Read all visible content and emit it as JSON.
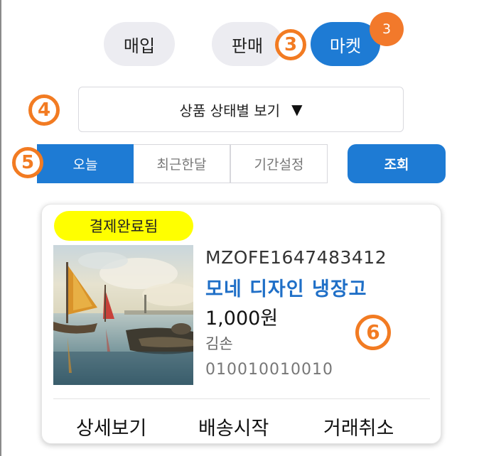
{
  "tabs": {
    "buy_label": "매입",
    "sell_label": "판매",
    "market_label": "마켓",
    "market_count": "3"
  },
  "markers": {
    "m3": "3",
    "m4": "4",
    "m5": "5",
    "m6": "6"
  },
  "filter": {
    "dropdown_label": "상품 상태별 보기",
    "dropdown_caret": "▼",
    "periods": [
      "오늘",
      "최근한달",
      "기간설정"
    ],
    "selected_period": "오늘",
    "search_label": "조회"
  },
  "order": {
    "status": "결제완료됨",
    "order_no": "MZOFE1647483412",
    "product_name": "모네 디자인 냉장고",
    "price": "1,000원",
    "buyer": "김손",
    "phone": "010010010010",
    "actions": [
      "상세보기",
      "배송시작",
      "거래취소"
    ]
  },
  "colors": {
    "accent": "#1e7bd4",
    "marker": "#f27b22",
    "badge": "#ffff00",
    "count_badge": "#f2792b"
  }
}
